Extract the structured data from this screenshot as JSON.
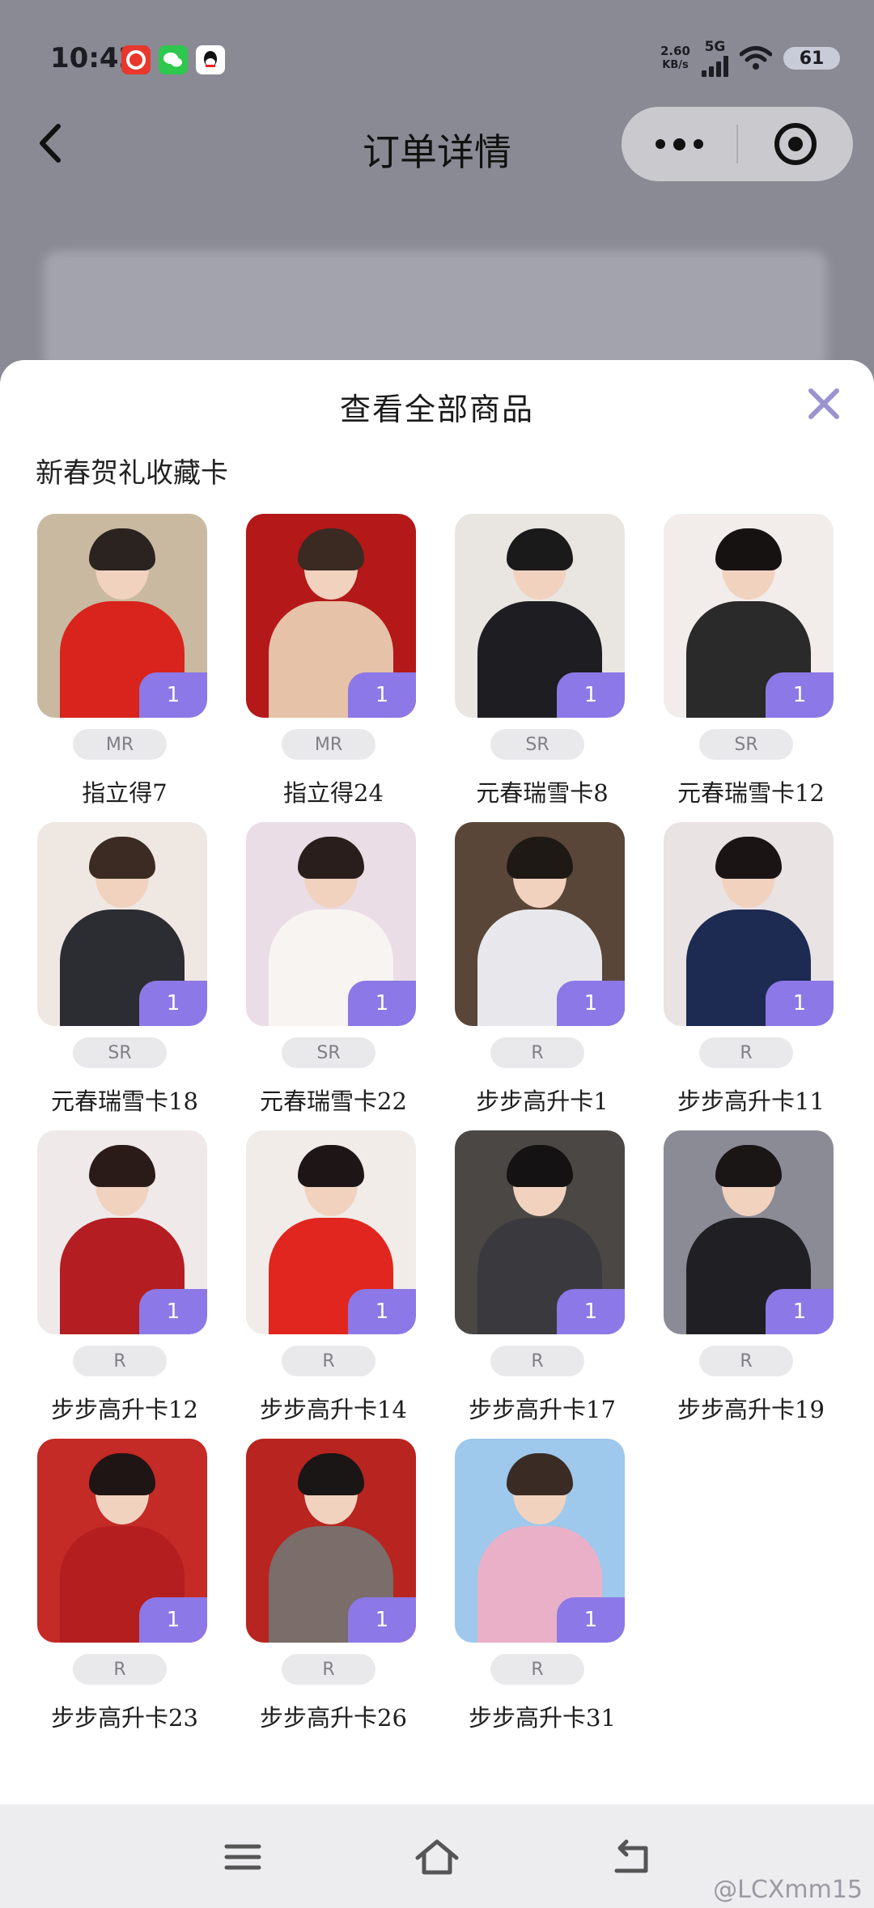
{
  "status_bar": {
    "time": "10:42",
    "net_speed_value": "2.60",
    "net_speed_unit": "KB/s",
    "network_type": "5G",
    "battery": "61",
    "app_icons": [
      "netease-music-icon",
      "wechat-icon",
      "qq-icon"
    ]
  },
  "nav": {
    "title": "订单详情",
    "back_icon": "chevron-left-icon",
    "more_icon": "more-dots-icon",
    "close_icon": "target-circle-icon"
  },
  "sheet": {
    "title": "查看全部商品",
    "close_icon": "close-x-icon",
    "section_title": "新春贺礼收藏卡",
    "accent": "#8c78e6",
    "cards": [
      {
        "name": "指立得7",
        "rarity": "MR",
        "qty": "1",
        "bg": "#c9b9a0",
        "cloth": "#d8241c",
        "hair": "#2a2320"
      },
      {
        "name": "指立得24",
        "rarity": "MR",
        "qty": "1",
        "bg": "#b41818",
        "cloth": "#e6c2a8",
        "hair": "#3a2a22"
      },
      {
        "name": "元春瑞雪卡8",
        "rarity": "SR",
        "qty": "1",
        "bg": "#e9e6e2",
        "cloth": "#1d1d22",
        "hair": "#1a1a1a"
      },
      {
        "name": "元春瑞雪卡12",
        "rarity": "SR",
        "qty": "1",
        "bg": "#f2ecea",
        "cloth": "#2a2a2a",
        "hair": "#161212"
      },
      {
        "name": "元春瑞雪卡18",
        "rarity": "SR",
        "qty": "1",
        "bg": "#efe7e2",
        "cloth": "#2c2c33",
        "hair": "#3b2b22"
      },
      {
        "name": "元春瑞雪卡22",
        "rarity": "SR",
        "qty": "1",
        "bg": "#eadde6",
        "cloth": "#f7f4f2",
        "hair": "#2a1e1c"
      },
      {
        "name": "步步高升卡1",
        "rarity": "R",
        "qty": "1",
        "bg": "#5a4638",
        "cloth": "#e8e8ec",
        "hair": "#1f1915"
      },
      {
        "name": "步步高升卡11",
        "rarity": "R",
        "qty": "1",
        "bg": "#eae3e3",
        "cloth": "#1d2a52",
        "hair": "#1a1414"
      },
      {
        "name": "步步高升卡12",
        "rarity": "R",
        "qty": "1",
        "bg": "#efe9ea",
        "cloth": "#b41e22",
        "hair": "#2a1a18"
      },
      {
        "name": "步步高升卡14",
        "rarity": "R",
        "qty": "1",
        "bg": "#f1ece8",
        "cloth": "#e0261e",
        "hair": "#1e1616"
      },
      {
        "name": "步步高升卡17",
        "rarity": "R",
        "qty": "1",
        "bg": "#4a4744",
        "cloth": "#3a3a3e",
        "hair": "#141212"
      },
      {
        "name": "步步高升卡19",
        "rarity": "R",
        "qty": "1",
        "bg": "#8b8b96",
        "cloth": "#202024",
        "hair": "#1a1616"
      },
      {
        "name": "步步高升卡23",
        "rarity": "R",
        "qty": "1",
        "bg": "#c42a26",
        "cloth": "#b51e1e",
        "hair": "#1f1515"
      },
      {
        "name": "步步高升卡26",
        "rarity": "R",
        "qty": "1",
        "bg": "#b82420",
        "cloth": "#7a6d6a",
        "hair": "#1a1616"
      },
      {
        "name": "步步高升卡31",
        "rarity": "R",
        "qty": "1",
        "bg": "#9ec8ec",
        "cloth": "#e9b0c8",
        "hair": "#3a2c24"
      }
    ]
  },
  "system_nav": {
    "menu_icon": "menu-lines-icon",
    "home_icon": "home-icon",
    "back_icon": "return-icon"
  },
  "watermark": "@LCXmm15"
}
